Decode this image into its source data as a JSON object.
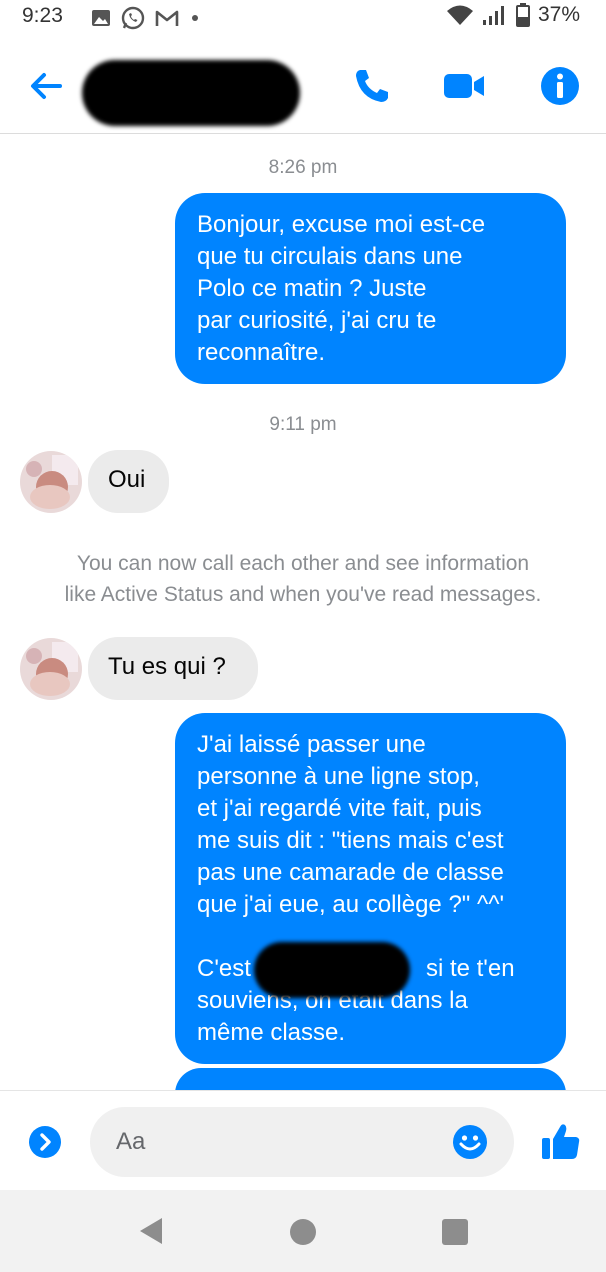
{
  "status_bar": {
    "time": "9:23",
    "battery": "37%",
    "left_icons": [
      "image-icon",
      "whatsapp-icon",
      "gmail-icon",
      "dot-icon"
    ],
    "right_icons": [
      "wifi-icon",
      "signal-icon",
      "battery-icon"
    ]
  },
  "header": {
    "contact_name": "",
    "buttons": [
      "back-arrow-icon",
      "phone-icon",
      "video-camera-icon",
      "info-icon"
    ],
    "accent_color": "#0084ff"
  },
  "messages": [
    {
      "type": "timestamp",
      "text": "8:26 pm"
    },
    {
      "type": "outgoing",
      "lines": [
        "Bonjour, excuse moi est-ce",
        "que tu circulais dans une",
        "Polo ce matin ? Juste",
        "par curiosité, j'ai cru te",
        "reconnaître."
      ]
    },
    {
      "type": "timestamp",
      "text": "9:11 pm"
    },
    {
      "type": "incoming",
      "text": "Oui"
    },
    {
      "type": "system",
      "lines": [
        "You can now call each other and see information",
        "like Active Status and when you've read messages."
      ]
    },
    {
      "type": "incoming",
      "text": "Tu es qui ?"
    },
    {
      "type": "outgoing",
      "lines": [
        "J'ai laissé passer une",
        "personne à une ligne stop,",
        "et j'ai regardé vite fait, puis",
        "me suis dit : \"tiens mais c'est",
        "pas une camarade de classe",
        "que j'ai eue, au collège ?\" ^^'",
        "",
        "C'est",
        "souviens, on était dans la",
        "même classe."
      ],
      "redacted_fragment_tail": "si te t'en"
    }
  ],
  "composer": {
    "placeholder": "Aa",
    "icons": [
      "expand-chevron-icon",
      "emoji-icon",
      "thumbs-up-icon"
    ]
  },
  "nav_bar": {
    "icons": [
      "nav-back-icon",
      "nav-home-icon",
      "nav-recents-icon"
    ]
  },
  "colors": {
    "outgoing_bubble": "#0084ff",
    "incoming_bubble": "#ebebeb",
    "meta_text": "#8a8d91"
  }
}
